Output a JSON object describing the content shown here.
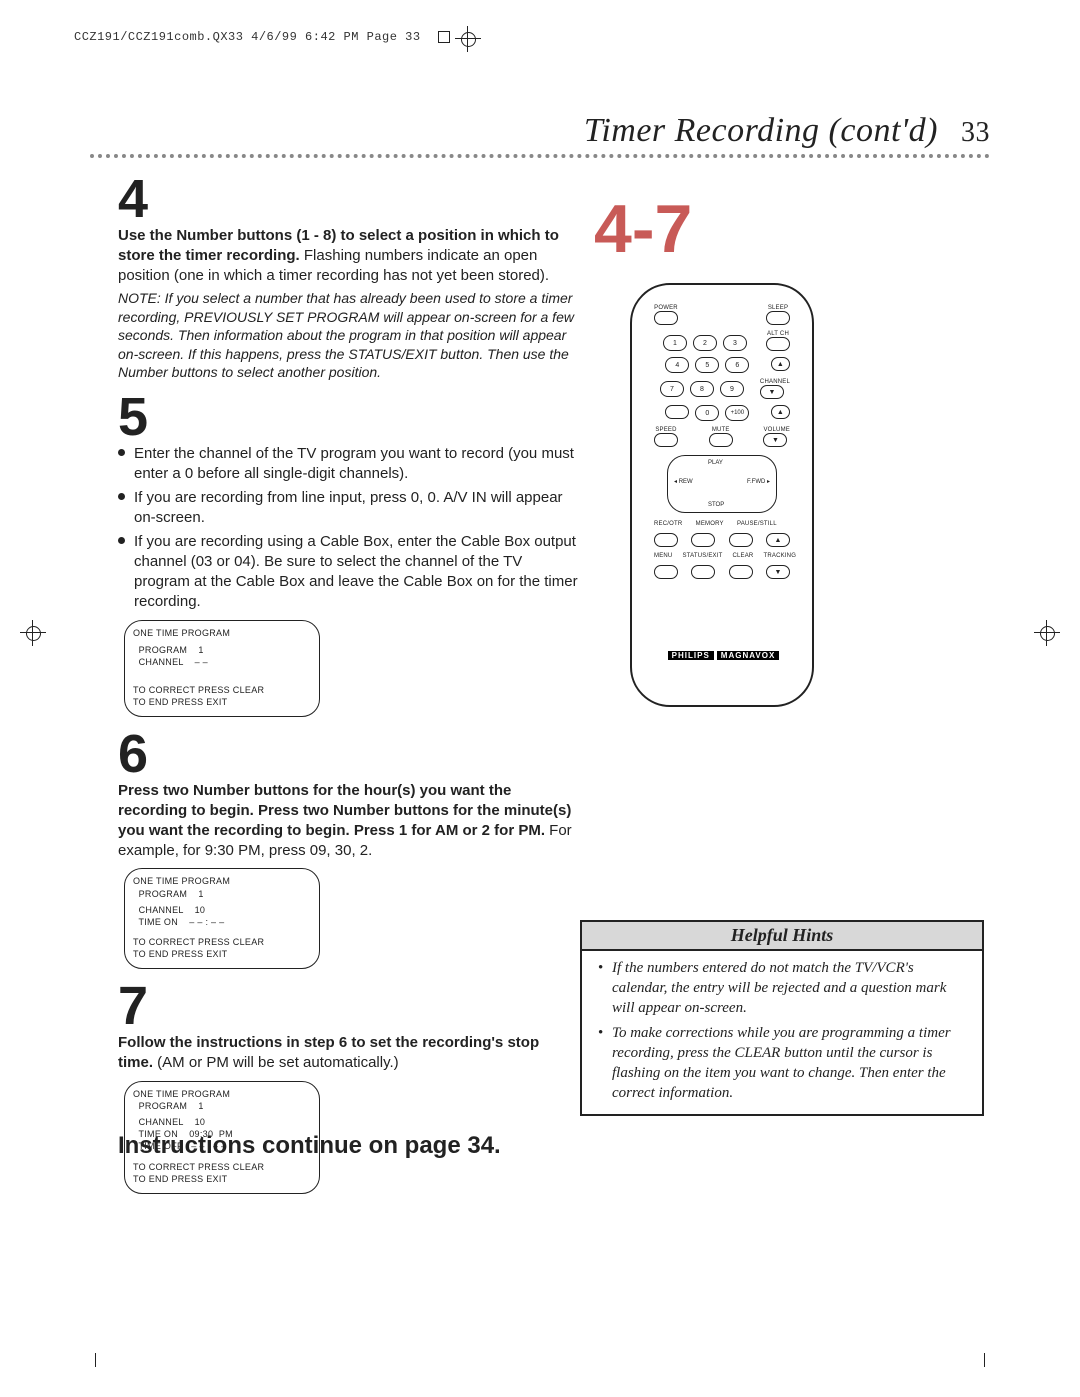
{
  "printer_mark": "CCZ191/CCZ191comb.QX33  4/6/99 6:42 PM  Page 33",
  "title": "Timer Recording (cont'd)",
  "page_number": "33",
  "right_badge": "4-7",
  "step4": {
    "num": "4",
    "bold": "Use the Number buttons (1 - 8) to select a position in which to store the timer recording.",
    "rest": " Flashing numbers indicate an open position (one in which a timer recording has not yet been stored).",
    "note": "NOTE: If you select a number that has already been used to store a timer recording, PREVIOUSLY SET PROGRAM will appear on-screen for a few seconds. Then information about the program in that position will appear on-screen. If this happens, press the STATUS/EXIT button. Then use the Number buttons to select another position."
  },
  "step5": {
    "num": "5",
    "items": [
      "Enter the channel of the TV program you want to record (you must enter a 0 before all single-digit channels).",
      "If you are recording from line input, press 0, 0.  A/V IN will appear on-screen.",
      "If you are recording using a Cable Box, enter the Cable Box output channel (03 or 04). Be sure to select the channel of the TV program at the Cable Box and leave the Cable Box on for the timer recording."
    ],
    "screen": {
      "l1": "ONE TIME PROGRAM",
      "l2": "  PROGRAM    1",
      "l3": "  CHANNEL    – –",
      "l4": "TO CORRECT PRESS CLEAR",
      "l5": "TO END PRESS EXIT"
    }
  },
  "step6": {
    "num": "6",
    "bold": "Press two Number buttons for the hour(s) you want the recording to begin. Press two Number buttons for the minute(s) you want the recording to begin. Press 1 for AM or 2 for PM.",
    "rest": " For example, for 9:30 PM, press 09, 30, 2.",
    "screen": {
      "l1": "ONE TIME PROGRAM",
      "l2": "  PROGRAM    1",
      "l3": "  CHANNEL    10",
      "l4": "  TIME ON    – – : – –",
      "l5": "TO CORRECT PRESS CLEAR",
      "l6": "TO END PRESS EXIT"
    }
  },
  "step7": {
    "num": "7",
    "bold": "Follow the instructions in step 6 to set the recording's stop time.",
    "rest": " (AM or PM will be set automatically.)",
    "screen": {
      "l1": "ONE TIME PROGRAM",
      "l2": "  PROGRAM    1",
      "l3": "  CHANNEL    10",
      "l4": "  TIME ON    09:30  PM",
      "l5": "  TIME OFF   – – : – –",
      "l6": "TO CORRECT PRESS CLEAR",
      "l7": "TO END PRESS EXIT"
    }
  },
  "continue": "Instructions continue on page 34.",
  "remote": {
    "brand": "PHILIPS",
    "brand2": "MAGNAVOX",
    "labels": {
      "power": "POWER",
      "sleep": "SLEEP",
      "alt": "ALT CH",
      "channel": "CHANNEL",
      "speed": "SPEED",
      "mute": "MUTE",
      "volume": "VOLUME",
      "play": "PLAY",
      "rew": "REW",
      "ffwd": "F.FWD",
      "stop": "STOP",
      "rec": "REC/OTR",
      "mem": "MEMORY",
      "pause": "PAUSE/STILL",
      "menu": "MENU",
      "status": "STATUS/EXIT",
      "clear": "CLEAR",
      "track": "TRACKING"
    },
    "buttons": {
      "b1": "1",
      "b2": "2",
      "b3": "3",
      "b4": "4",
      "b5": "5",
      "b6": "6",
      "b7": "7",
      "b8": "8",
      "b9": "9",
      "b0": "0",
      "b100": "+100",
      "au": "▲",
      "ad": "▼",
      "vu": "▲",
      "vd": "▼",
      "tu": "▲",
      "td": "▼"
    }
  },
  "hints": {
    "title": "Helpful Hints",
    "items": [
      "If the numbers entered do not match the TV/VCR's calendar, the entry will be rejected and a question mark will appear on-screen.",
      "To make corrections while you are programming a timer recording, press the CLEAR button until the cursor is flashing on the item you want to change. Then enter the correct information."
    ]
  }
}
